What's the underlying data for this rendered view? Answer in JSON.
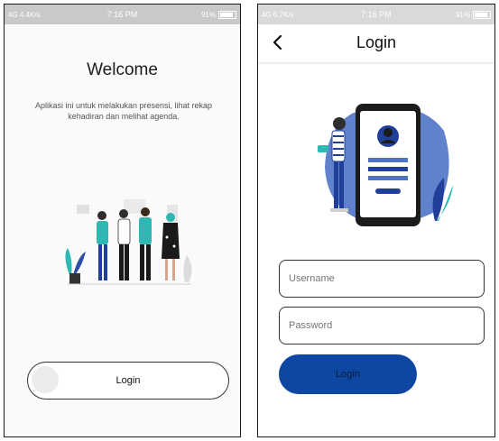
{
  "status_left": {
    "network": "4G",
    "speed": "4.4K/s",
    "time": "7:16 PM",
    "battery": "91%"
  },
  "status_right": {
    "network": "4G",
    "speed": "6.7K/s",
    "time": "7:16 PM",
    "battery": "91%"
  },
  "welcome": {
    "title": "Welcome",
    "description": "Aplikasi ini untuk melakukan presensi, lihat rekap kehadiran dan melihat agenda.",
    "login_label": "Login"
  },
  "login_screen": {
    "title": "Login",
    "username_placeholder": "Username",
    "password_placeholder": "Password",
    "login_label": "Login"
  },
  "colors": {
    "primary": "#0d47a1",
    "illustration_blue": "#4f74c7",
    "illustration_teal": "#2fb7b4"
  }
}
